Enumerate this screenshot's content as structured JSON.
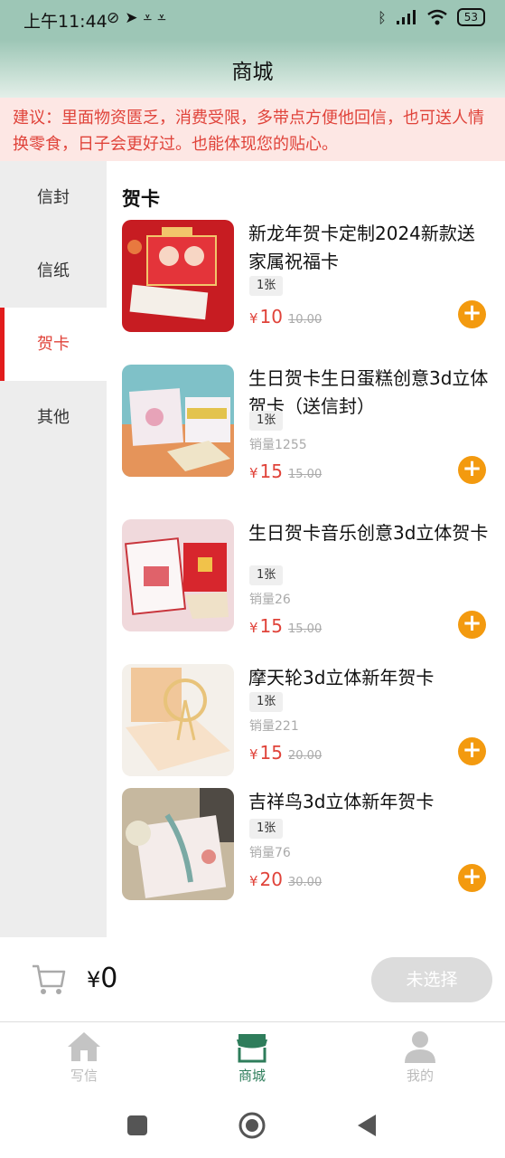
{
  "status": {
    "time": "上午11:44",
    "battery": "53"
  },
  "header": {
    "title": "商城"
  },
  "notice": {
    "text": "建议：里面物资匮乏，消费受限，多带点方便他回信，也可送人情换零食，日子会更好过。也能体现您的贴心。"
  },
  "categories": [
    {
      "label": "信封",
      "active": false
    },
    {
      "label": "信纸",
      "active": false
    },
    {
      "label": "贺卡",
      "active": true
    },
    {
      "label": "其他",
      "active": false
    }
  ],
  "section": {
    "title": "贺卡"
  },
  "products": [
    {
      "name": "新龙年贺卡定制2024新款送家属祝福卡",
      "tag": "1张",
      "sales": "",
      "currency": "¥",
      "price": "10",
      "old_price": "10.00"
    },
    {
      "name": "生日贺卡生日蛋糕创意3d立体贺卡（送信封）",
      "tag": "1张",
      "sales": "销量1255",
      "currency": "¥",
      "price": "15",
      "old_price": "15.00"
    },
    {
      "name": "生日贺卡音乐创意3d立体贺卡",
      "tag": "1张",
      "sales": "销量26",
      "currency": "¥",
      "price": "15",
      "old_price": "15.00"
    },
    {
      "name": "摩天轮3d立体新年贺卡",
      "tag": "1张",
      "sales": "销量221",
      "currency": "¥",
      "price": "15",
      "old_price": "20.00"
    },
    {
      "name": "吉祥鸟3d立体新年贺卡",
      "tag": "1张",
      "sales": "销量76",
      "currency": "¥",
      "price": "20",
      "old_price": "30.00"
    }
  ],
  "cart": {
    "currency": "¥",
    "total": "0",
    "button_label": "未选择"
  },
  "tabs": [
    {
      "label": "写信",
      "icon": "home-icon",
      "active": false
    },
    {
      "label": "商城",
      "icon": "store-icon",
      "active": true
    },
    {
      "label": "我的",
      "icon": "user-icon",
      "active": false
    }
  ],
  "colors": {
    "accent": "#e0433a",
    "add_button": "#f39a0f",
    "header_green": "#9dc6b6",
    "tab_active": "#2e7d5b"
  }
}
